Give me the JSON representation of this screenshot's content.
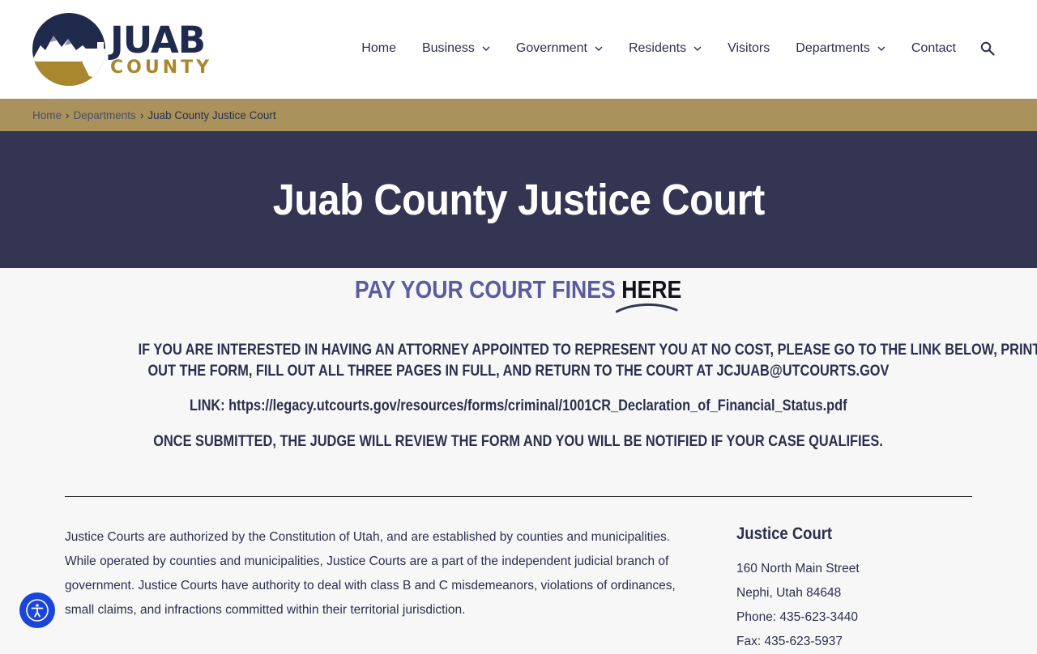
{
  "logo": {
    "line1": "JUAB",
    "line2": "COUNTY"
  },
  "nav": {
    "items": [
      {
        "label": "Home",
        "has_dropdown": false
      },
      {
        "label": "Business",
        "has_dropdown": true
      },
      {
        "label": "Government",
        "has_dropdown": true
      },
      {
        "label": "Residents",
        "has_dropdown": true
      },
      {
        "label": "Visitors",
        "has_dropdown": false
      },
      {
        "label": "Departments",
        "has_dropdown": true
      },
      {
        "label": "Contact",
        "has_dropdown": false
      }
    ],
    "search_icon": "search-icon"
  },
  "breadcrumb": {
    "items": [
      "Home",
      "Departments"
    ],
    "separator": "›",
    "current": "Juab County Justice Court"
  },
  "hero": {
    "title": "Juab County Justice Court"
  },
  "pay": {
    "text": "PAY YOUR COURT FINES ",
    "link": "HERE"
  },
  "notices": {
    "attorney_line1": "IF YOU ARE INTERESTED IN HAVING AN ATTORNEY APPOINTED TO REPRESENT YOU AT NO COST, PLEASE GO TO THE LINK BELOW, PRINT",
    "attorney_line2": "OUT THE FORM, FILL OUT ALL THREE PAGES IN FULL, AND RETURN TO THE COURT AT JCJUAB@UTCOURTS.GOV",
    "link_label": "LINK: ",
    "link_url": "https://legacy.utcourts.gov/resources/forms/criminal/1001CR_Declaration_of_Financial_Status.pdf",
    "submitted": "ONCE SUBMITTED, THE JUDGE WILL REVIEW THE FORM AND YOU WILL BE NOTIFIED IF YOUR CASE QUALIFIES."
  },
  "about": {
    "text": "Justice Courts are authorized by the Constitution of Utah, and are established by counties and municipalities. While operated by counties and municipalities, Justice Courts are a part of the independent judicial branch of government. Justice Courts have authority to deal with class B and C misdemeanors, violations of ordinances, small claims, and infractions committed within their territorial jurisdiction."
  },
  "sidebar": {
    "title": "Justice Court",
    "address1": "160 North Main Street",
    "address2": "Nephi, Utah 84648",
    "phone": "Phone: 435-623-3440",
    "fax": "Fax: 435-623-5937"
  },
  "colors": {
    "header_bg": "#ffffff",
    "breadcrumb_bg": "#a9925c",
    "hero_bg": "#333553",
    "pay_text": "#5a5ba0",
    "body_text": "#2b2f4e",
    "logo_navy": "#1f2a4d",
    "logo_gold": "#a9872f",
    "accessibility_button": "#1a45d9"
  },
  "accessibility": {
    "icon": "accessibility-icon"
  }
}
